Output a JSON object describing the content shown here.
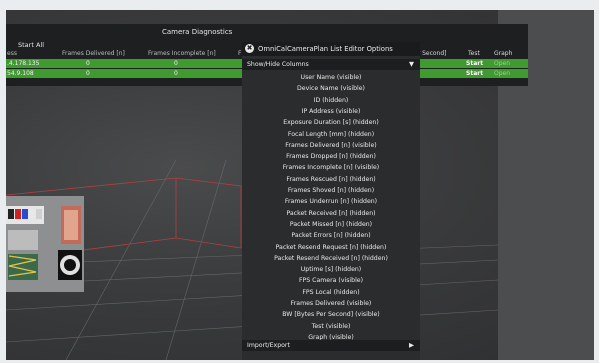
{
  "diagnostics": {
    "title": "Camera Diagnostics",
    "start_all": "Start All",
    "columns": [
      "ess",
      "Frames Delivered [n]",
      "Frames Incomplete [n]",
      "F",
      "er Second]",
      "Test",
      "Graph"
    ],
    "rows": [
      {
        "address": ".4.178.135",
        "frames_delivered": "0",
        "frames_incomplete": "0",
        "start": "Start",
        "graph": "Open"
      },
      {
        "address": "54.9.108",
        "frames_delivered": "0",
        "frames_incomplete": "0",
        "start": "Start",
        "graph": "Open"
      }
    ]
  },
  "editor": {
    "close_glyph": "✖",
    "title": "OmniCalCameraPlan List Editor Options",
    "show_hide": {
      "label": "Show/Hide Columns",
      "arrow": "▼"
    },
    "columns": [
      "User Name (visible)",
      "Device Name (visible)",
      "ID (hidden)",
      "IP Address (visible)",
      "Exposure Duration [s] (hidden)",
      "Focal Length [mm] (hidden)",
      "Frames Delivered [n] (visible)",
      "Frames Dropped [n] (hidden)",
      "Frames Incomplete [n] (visible)",
      "Frames Rescued [n] (hidden)",
      "Frames Shoved [n] (hidden)",
      "Frames Underrun [n] (hidden)",
      "Packet Received [n] (hidden)",
      "Packet Missed [n] (hidden)",
      "Packet Errors [n] (hidden)",
      "Packet Resend Request [n] (hidden)",
      "Packet Resend Received [n] (hidden)",
      "Uptime [s] (hidden)",
      "FPS Camera (visible)",
      "FPS Local (hidden)",
      "Frames Delivered (visible)",
      "BW [Bytes Per Second] (visible)",
      "Test (visible)",
      "Graph (visible)"
    ],
    "import_export": {
      "label": "Import/Export",
      "arrow": "▶"
    }
  },
  "colors": {
    "row_green": "#3f9a2f",
    "accent_red": "#d8342b"
  }
}
